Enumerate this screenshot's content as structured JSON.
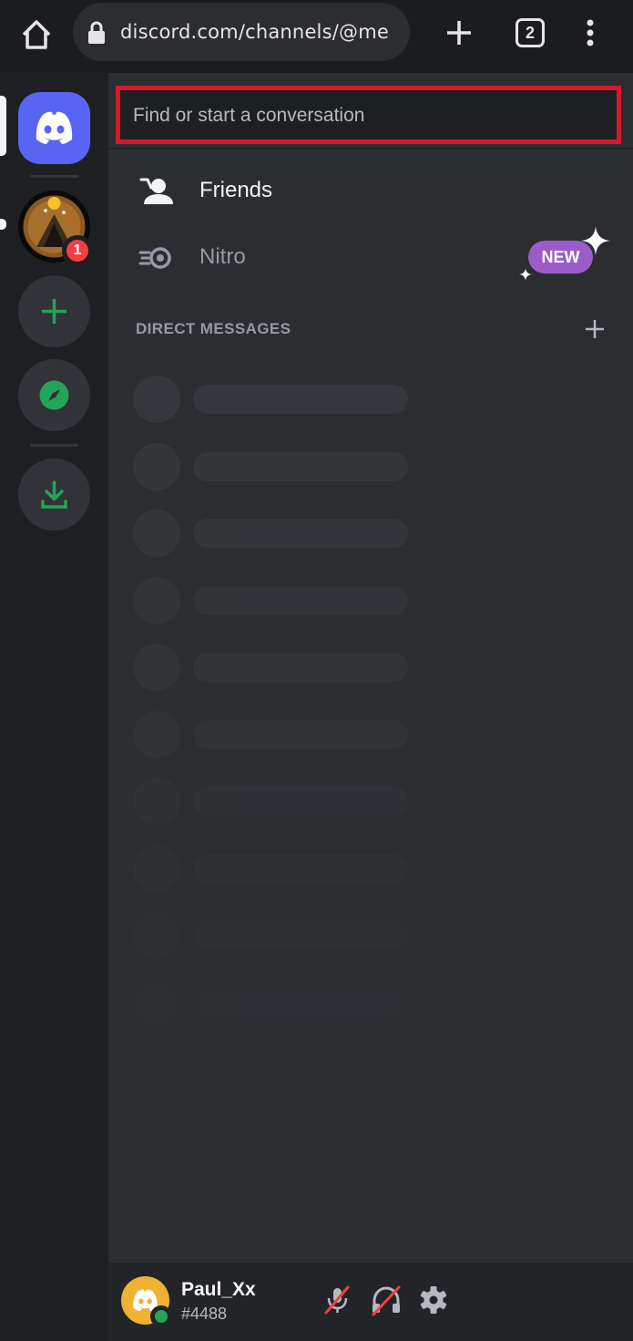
{
  "browser": {
    "url": "discord.com/channels/@me",
    "tab_count": "2"
  },
  "rail": {
    "unread_badge": "1"
  },
  "search": {
    "placeholder": "Find or start a conversation"
  },
  "nav": {
    "friends_label": "Friends",
    "nitro_label": "Nitro",
    "new_badge": "NEW"
  },
  "dm": {
    "header": "DIRECT MESSAGES",
    "placeholder_rows": 10
  },
  "user": {
    "name": "Paul_Xx",
    "tag": "#4488",
    "status": "online"
  },
  "colors": {
    "blurple": "#5865f2",
    "green": "#23a559",
    "red": "#f23f42",
    "nitro_new": "#9b5cc9",
    "highlight_box": "#d7182a"
  }
}
